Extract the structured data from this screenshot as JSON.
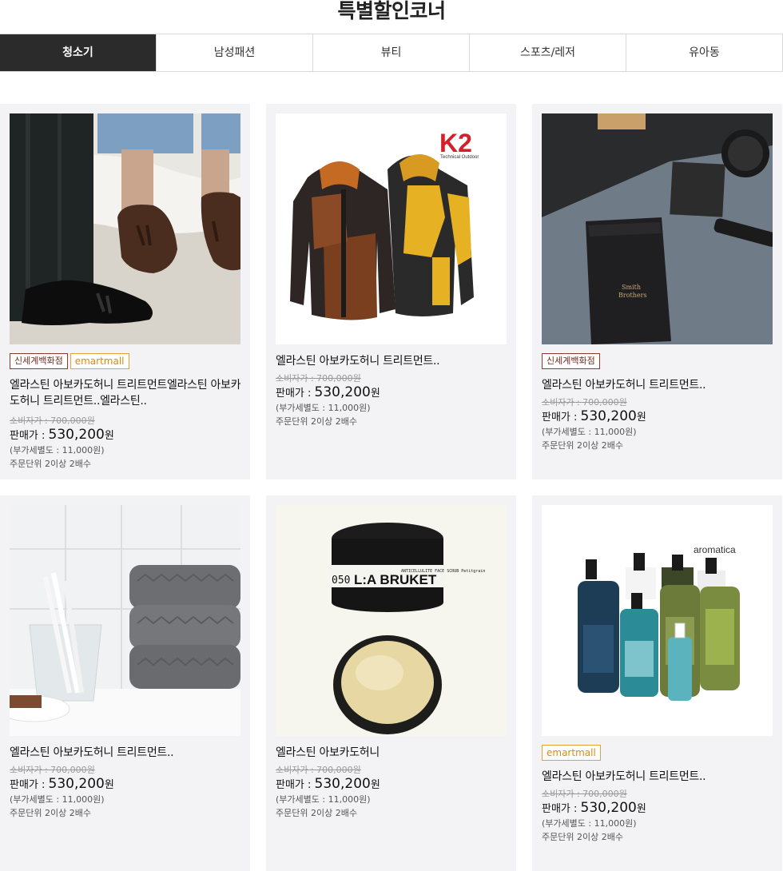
{
  "page": {
    "title": "특별할인코너"
  },
  "tabs": [
    {
      "label": "청소기",
      "active": true
    },
    {
      "label": "남성패션",
      "active": false
    },
    {
      "label": "뷰티",
      "active": false
    },
    {
      "label": "스포츠/레저",
      "active": false
    },
    {
      "label": "유아동",
      "active": false
    }
  ],
  "products": [
    {
      "badges": [
        "신세계백화점",
        "emartmall"
      ],
      "name": "엘라스틴 아보카도허니 트리트먼트엘라스틴 아보카도허니 트리트먼트..엘라스틴..",
      "consumer_price": "소비자가 : 700,000원",
      "price_label": "판매가 : ",
      "price_value": "530,200",
      "price_unit": "원",
      "vat": "(부가세별도 : 11,000원)",
      "order_unit": "주문단위 2이상 2배수",
      "image": "loafers"
    },
    {
      "badges": [],
      "name": "엘라스틴 아보카도허니 트리트먼트..",
      "consumer_price": "소비자가 : 700,000원",
      "price_label": "판매가 : ",
      "price_value": "530,200",
      "price_unit": "원",
      "vat": "(부가세별도 : 11,000원)",
      "order_unit": "주문단위 2이상 2배수",
      "image": "jackets",
      "logo_text": "K2",
      "logo_sub": "Technical Outdoor"
    },
    {
      "badges": [
        "신세계백화점"
      ],
      "name": "엘라스틴 아보카도허니 트리트먼트..",
      "consumer_price": "소비자가 : 700,000원",
      "price_label": "판매가 : ",
      "price_value": "530,200",
      "price_unit": "원",
      "vat": "(부가세별도 : 11,000원)",
      "order_unit": "주문단위 2이상 2배수",
      "image": "cosmetics"
    },
    {
      "badges": [],
      "name": "엘라스틴 아보카도허니 트리트먼트..",
      "consumer_price": "소비자가 : 700,000원",
      "price_label": "판매가 : ",
      "price_value": "530,200",
      "price_unit": "원",
      "vat": "(부가세별도 : 11,000원)",
      "order_unit": "주문단위 2이상 2배수",
      "image": "towels"
    },
    {
      "badges": [],
      "name": "엘라스틴 아보카도허니",
      "consumer_price": "소비자가 : 700,000원",
      "price_label": "판매가 : ",
      "price_value": "530,200",
      "price_unit": "원",
      "vat": "(부가세별도 : 11,000원)",
      "order_unit": "주문단위 2이상 2배수",
      "image": "scrub",
      "label_brand": "L:A BRUKET",
      "label_num": "050",
      "label_desc": "ANTICELLULITE FACE SCRUB Petitgrain"
    },
    {
      "badges": [
        "emartmall"
      ],
      "name": "엘라스틴 아보카도허니 트리트먼트..",
      "consumer_price": "소비자가 : 700,000원",
      "price_label": "판매가 : ",
      "price_value": "530,200",
      "price_unit": "원",
      "vat": "(부가세별도 : 11,000원)",
      "order_unit": "주문단위 2이상 2배수",
      "image": "bottles",
      "brand_logo": "aromatica"
    }
  ]
}
